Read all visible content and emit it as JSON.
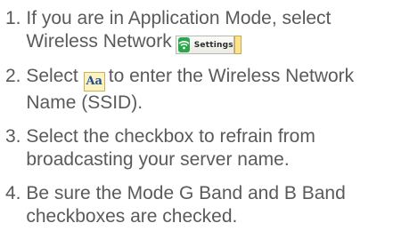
{
  "steps": [
    {
      "number": "1. ",
      "text_before": "If you are in Application Mode, select Wireless Network",
      "icon": "wifi-settings-button",
      "icon_label": "Settings"
    },
    {
      "number": "2. ",
      "text_before": "Select",
      "icon": "text-edit-aa-icon",
      "icon_label": "Aa",
      "text_after": "to enter the Wireless Network Name (SSID)."
    },
    {
      "number": "3. ",
      "text": "Select the checkbox to refrain from broadcasting your server name."
    },
    {
      "number": "4. ",
      "text": "Be sure the Mode G Band and B Band checkboxes are checked."
    }
  ],
  "colors": {
    "text": "#5a5a5a",
    "wifi_badge": "#2aa64d",
    "aa_icon_bg": "#fdf3c0",
    "aa_icon_text": "#1d4f94"
  }
}
